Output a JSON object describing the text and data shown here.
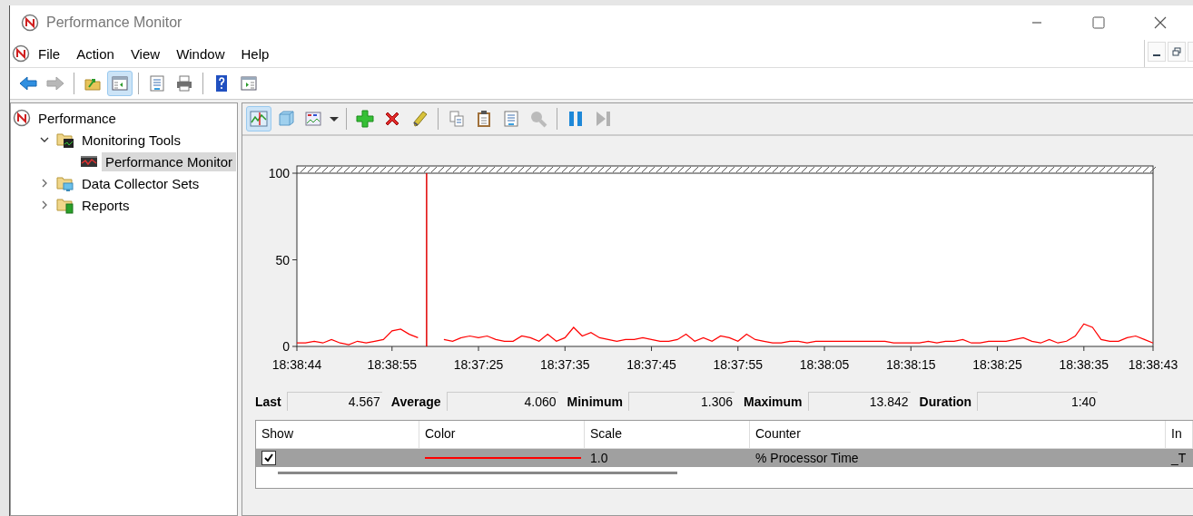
{
  "window": {
    "title": "Performance Monitor"
  },
  "menu": {
    "items": [
      "File",
      "Action",
      "View",
      "Window",
      "Help"
    ]
  },
  "toolbar": {
    "groups": [
      [
        {
          "kind": "back",
          "selected": false,
          "disabled": false
        },
        {
          "kind": "forward",
          "selected": false,
          "disabled": true
        }
      ],
      [
        {
          "kind": "up",
          "selected": false,
          "disabled": false
        },
        {
          "kind": "tree-toggle",
          "selected": true,
          "disabled": false
        }
      ],
      [
        {
          "kind": "properties",
          "selected": false,
          "disabled": false
        },
        {
          "kind": "print",
          "selected": false,
          "disabled": false
        }
      ],
      [
        {
          "kind": "help",
          "selected": false,
          "disabled": false
        },
        {
          "kind": "action-pane",
          "selected": false,
          "disabled": false
        }
      ]
    ]
  },
  "tree": [
    {
      "label": "Performance",
      "kind": "performance",
      "selected": false,
      "children": [
        {
          "label": "Monitoring Tools",
          "kind": "folder-monitor",
          "expanded": true,
          "selected": false,
          "children": [
            {
              "label": "Performance Monitor",
              "kind": "monitor",
              "selected": true
            }
          ]
        },
        {
          "label": "Data Collector Sets",
          "kind": "folder-collector",
          "expanded": false,
          "selected": false
        },
        {
          "label": "Reports",
          "kind": "folder-report",
          "expanded": false,
          "selected": false
        }
      ]
    }
  ],
  "chart_toolbar": {
    "groups": [
      [
        {
          "kind": "graph",
          "selected": true,
          "disabled": false
        },
        {
          "kind": "freeze",
          "selected": false,
          "disabled": false
        },
        {
          "kind": "graph-type",
          "selected": false,
          "disabled": false
        },
        {
          "kind": "dropdown",
          "selected": false,
          "disabled": false
        }
      ],
      [
        {
          "kind": "add",
          "selected": false,
          "disabled": false
        },
        {
          "kind": "delete",
          "selected": false,
          "disabled": false
        },
        {
          "kind": "highlight",
          "selected": false,
          "disabled": false
        }
      ],
      [
        {
          "kind": "copy",
          "selected": false,
          "disabled": false
        },
        {
          "kind": "paste",
          "selected": false,
          "disabled": false
        },
        {
          "kind": "properties",
          "selected": false,
          "disabled": false
        },
        {
          "kind": "zoom",
          "selected": false,
          "disabled": true
        }
      ],
      [
        {
          "kind": "pause",
          "selected": false,
          "disabled": false
        },
        {
          "kind": "update",
          "selected": false,
          "disabled": true
        }
      ]
    ]
  },
  "chart_data": {
    "type": "line",
    "categories": [
      "18:38:44",
      null,
      null,
      null,
      null,
      null,
      null,
      null,
      null,
      null,
      null,
      "18:38:55",
      null,
      null,
      null,
      null,
      null,
      null,
      null,
      null,
      null,
      "18:37:25",
      null,
      null,
      null,
      null,
      null,
      null,
      null,
      null,
      null,
      "18:37:35",
      null,
      null,
      null,
      null,
      null,
      null,
      null,
      null,
      null,
      "18:37:45",
      null,
      null,
      null,
      null,
      null,
      null,
      null,
      null,
      null,
      "18:37:55",
      null,
      null,
      null,
      null,
      null,
      null,
      null,
      null,
      null,
      "18:38:05",
      null,
      null,
      null,
      null,
      null,
      null,
      null,
      null,
      null,
      "18:38:15",
      null,
      null,
      null,
      null,
      null,
      null,
      null,
      null,
      null,
      "18:38:25",
      null,
      null,
      null,
      null,
      null,
      null,
      null,
      null,
      null,
      "18:38:35",
      null,
      null,
      null,
      null,
      null,
      null,
      null,
      "18:38:43"
    ],
    "series": [
      {
        "color": "#ff0000",
        "values": [
          2,
          2,
          3,
          2,
          4,
          2,
          1,
          3,
          2,
          3,
          4,
          9,
          10,
          7,
          5,
          null,
          null,
          4,
          3,
          5,
          6,
          5,
          6,
          4,
          3,
          3,
          6,
          5,
          3,
          7,
          3,
          5,
          11,
          6,
          8,
          5,
          4,
          3,
          4,
          4,
          5,
          4,
          3,
          3,
          4,
          7,
          3,
          5,
          3,
          6,
          5,
          3,
          7,
          4,
          3,
          2,
          2,
          3,
          3,
          2,
          3,
          3,
          3,
          3,
          3,
          3,
          3,
          3,
          3,
          2,
          2,
          2,
          2,
          3,
          2,
          3,
          3,
          4,
          2,
          2,
          3,
          3,
          3,
          4,
          5,
          3,
          2,
          4,
          2,
          3,
          6,
          13,
          11,
          4,
          3,
          3,
          5,
          6,
          4,
          2
        ]
      }
    ],
    "ylim": [
      0,
      100
    ],
    "yticks": [
      0,
      50,
      100
    ]
  },
  "stats": [
    {
      "label": "Last",
      "value": "4.567"
    },
    {
      "label": "Average",
      "value": "4.060"
    },
    {
      "label": "Minimum",
      "value": "1.306"
    },
    {
      "label": "Maximum",
      "value": "13.842"
    },
    {
      "label": "Duration",
      "value": "1:40"
    }
  ],
  "counters": {
    "columns": [
      "Show",
      "Color",
      "Scale",
      "Counter",
      "In"
    ],
    "rows": [
      {
        "checked": true,
        "selected": true,
        "color": "#ff0000",
        "scale": "1.0",
        "counter": "% Processor Time",
        "column_5": "_T"
      }
    ]
  }
}
